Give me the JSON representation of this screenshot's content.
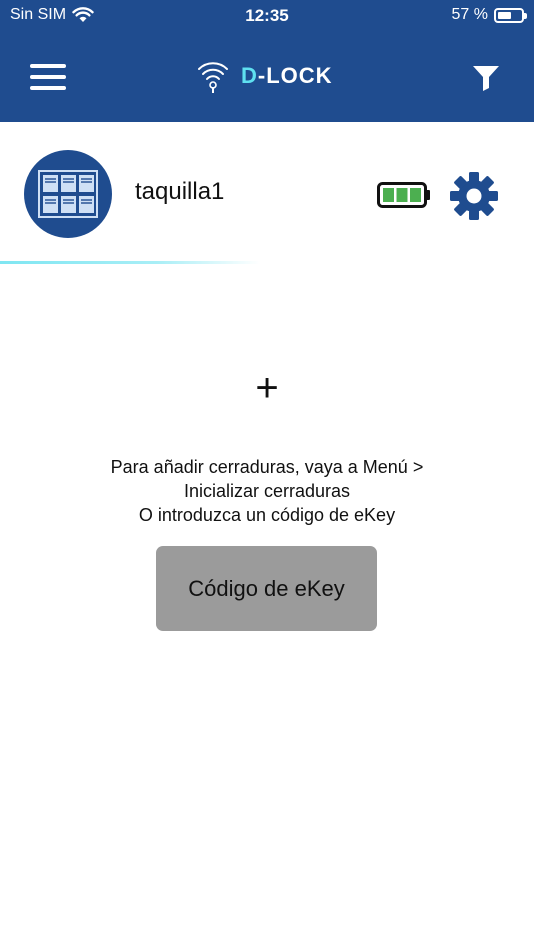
{
  "status_bar": {
    "carrier": "Sin SIM",
    "time": "12:35",
    "battery_percent": "57 %",
    "battery_level": 0.57
  },
  "header": {
    "brand": {
      "prefix": "D",
      "suffix": "-LOCK"
    },
    "menu_icon": "hamburger-menu-icon",
    "filter_icon": "filter-funnel-icon",
    "background_color": "#1f4c8f"
  },
  "lock": {
    "name": "taquilla1",
    "avatar_icon": "locker-icon",
    "battery_icon": "battery-full-icon",
    "battery_level": 1.0,
    "battery_color": "#4caf50",
    "settings_icon": "gear-icon"
  },
  "empty_state": {
    "plus_symbol": "+",
    "line1": "Para añadir cerraduras, vaya a Menú >",
    "line2": "Inicializar cerraduras",
    "line3": "O introduzca un código de eKey",
    "ekey_button_label": "Código de eKey"
  }
}
